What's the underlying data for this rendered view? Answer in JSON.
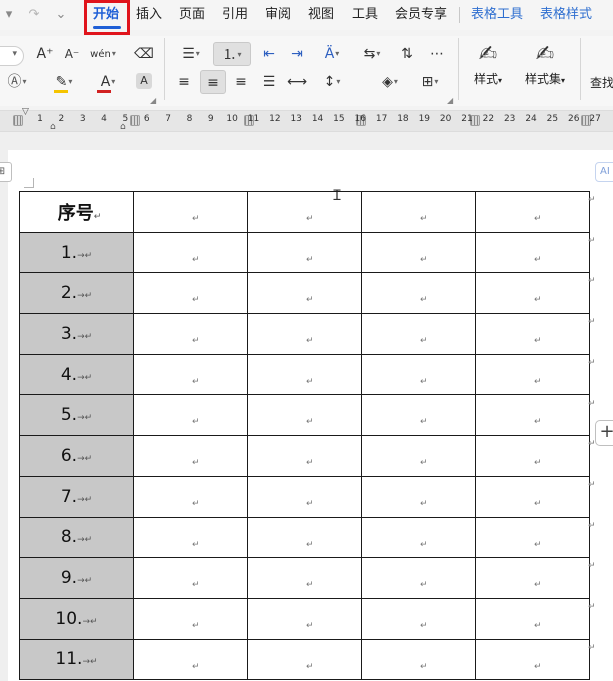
{
  "menu": {
    "undo_icon": "undo-icon",
    "redo_icon": "redo-icon",
    "more_icon": "chevron-down-icon",
    "tabs": [
      {
        "label": "开始",
        "active": true
      },
      {
        "label": "插入"
      },
      {
        "label": "页面"
      },
      {
        "label": "引用"
      },
      {
        "label": "审阅"
      },
      {
        "label": "视图"
      },
      {
        "label": "工具"
      },
      {
        "label": "会员专享"
      }
    ],
    "context_tabs": [
      {
        "label": "表格工具"
      },
      {
        "label": "表格样式"
      }
    ],
    "highlight_color": "#e0141c",
    "accent_color": "#1f5fd6"
  },
  "ribbon": {
    "font_color": "#d12121",
    "highlight_color": "#f5c400",
    "font_color_label": "A",
    "highlight_label": "A",
    "char_shading_label": "A",
    "grow_font_label": "A⁺",
    "shrink_font_label": "A⁻",
    "phonetic_label": "wén",
    "styles_label": "样式",
    "style_set_label": "样式集",
    "find_label": "查找",
    "dropdown_glyph": "▾"
  },
  "ruler": {
    "numbers": [
      "1",
      "2",
      "3",
      "4",
      "5",
      "6",
      "7",
      "8",
      "9",
      "10",
      "11",
      "12",
      "13",
      "14",
      "15",
      "16",
      "17",
      "18",
      "19",
      "20",
      "21",
      "22",
      "23",
      "24",
      "25",
      "26",
      "27"
    ]
  },
  "document": {
    "table_handle_glyph": "⊞",
    "ai_label": "AI",
    "add_column_glyph": "+",
    "para_mark": "↵",
    "tab_mark": "→",
    "header": {
      "sequence": "序号"
    },
    "rows": [
      {
        "sequence": "1."
      },
      {
        "sequence": "2."
      },
      {
        "sequence": "3."
      },
      {
        "sequence": "4."
      },
      {
        "sequence": "5."
      },
      {
        "sequence": "6."
      },
      {
        "sequence": "7."
      },
      {
        "sequence": "8."
      },
      {
        "sequence": "9."
      },
      {
        "sequence": "10."
      },
      {
        "sequence": "11."
      }
    ],
    "shading_color": "#c8c8c8"
  }
}
